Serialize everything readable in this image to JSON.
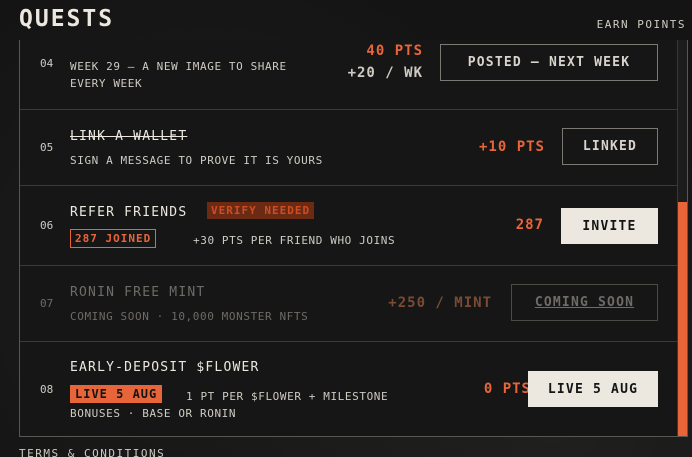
{
  "header": {
    "title": "QUESTS",
    "earn_label": "EARN POINTS"
  },
  "quests": [
    {
      "num": "04",
      "desc": "WEEK 29 — A NEW IMAGE TO SHARE EVERY WEEK",
      "points_total": "40 PTS",
      "points": "+20 / WK",
      "button": "POSTED — NEXT WEEK"
    },
    {
      "num": "05",
      "title": "LINK A WALLET",
      "desc": "SIGN A MESSAGE TO PROVE IT IS YOURS",
      "points": "+10 PTS",
      "button": "LINKED"
    },
    {
      "num": "06",
      "title": "REFER FRIENDS",
      "badge": "VERIFY NEEDED",
      "joined": "287 JOINED",
      "desc": "+30 PTS PER FRIEND WHO JOINS",
      "points": "287",
      "button": "INVITE"
    },
    {
      "num": "07",
      "title": "RONIN FREE MINT",
      "desc": "COMING SOON · 10,000 MONSTER NFTS",
      "points": "+250 / MINT",
      "button": "COMING SOON"
    },
    {
      "num": "08",
      "title": "EARLY-DEPOSIT $FLOWER",
      "badge": "LIVE 5 AUG",
      "desc_line1": "1 PT PER $FLOWER + MILESTONE",
      "desc_line2": "BONUSES · BASE OR RONIN",
      "points": "0 PTS",
      "button": "LIVE 5 AUG"
    }
  ],
  "footer": {
    "terms": "TERMS & CONDITIONS"
  },
  "colors": {
    "accent": "#e8653a",
    "background": "#141414",
    "text": "#ece8e0"
  }
}
